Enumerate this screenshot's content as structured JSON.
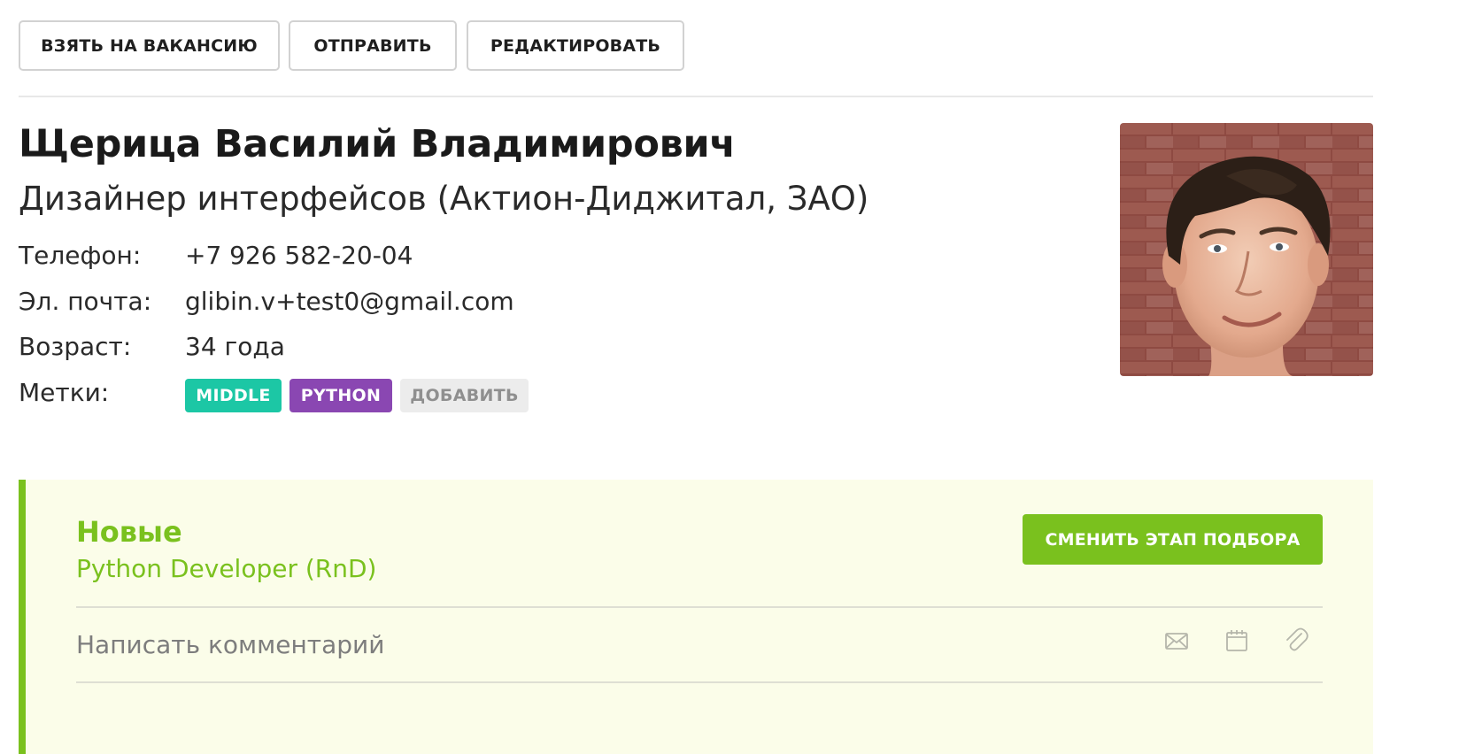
{
  "toolbar": {
    "take_to_vacancy": "ВЗЯТЬ НА ВАКАНСИЮ",
    "send": "ОТПРАВИТЬ",
    "edit": "РЕДАКТИРОВАТЬ"
  },
  "candidate": {
    "full_name": "Щерица Василий Владимирович",
    "position": "Дизайнер интерфейсов (Актион-Диджитал, ЗАО)",
    "fields": [
      {
        "label": "Телефон:",
        "value": "+7 926 582-20-04"
      },
      {
        "label": "Эл. почта:",
        "value": "glibin.v+test0@gmail.com"
      },
      {
        "label": "Возраст:",
        "value": "34 года"
      },
      {
        "label": "Метки:"
      }
    ],
    "tags": [
      {
        "label": "MIDDLE",
        "color": "#1cc7a5"
      },
      {
        "label": "PYTHON",
        "color": "#8a47b2"
      }
    ],
    "add_tag_label": "ДОБАВИТЬ",
    "photo_icon": "avatar-photo"
  },
  "stage": {
    "name": "Новые",
    "vacancy": "Python Developer (RnD)",
    "change_button": "СМЕНИТЬ ЭТАП ПОДБОРА",
    "comment_placeholder": "Написать комментарий",
    "actions": [
      "envelope-icon",
      "calendar-icon",
      "paperclip-icon"
    ]
  },
  "colors": {
    "accent_green": "#7ac11e",
    "panel_bg": "#fbfde9",
    "tag_add_bg": "#ececec",
    "tag_add_text": "#8f8f8f"
  }
}
